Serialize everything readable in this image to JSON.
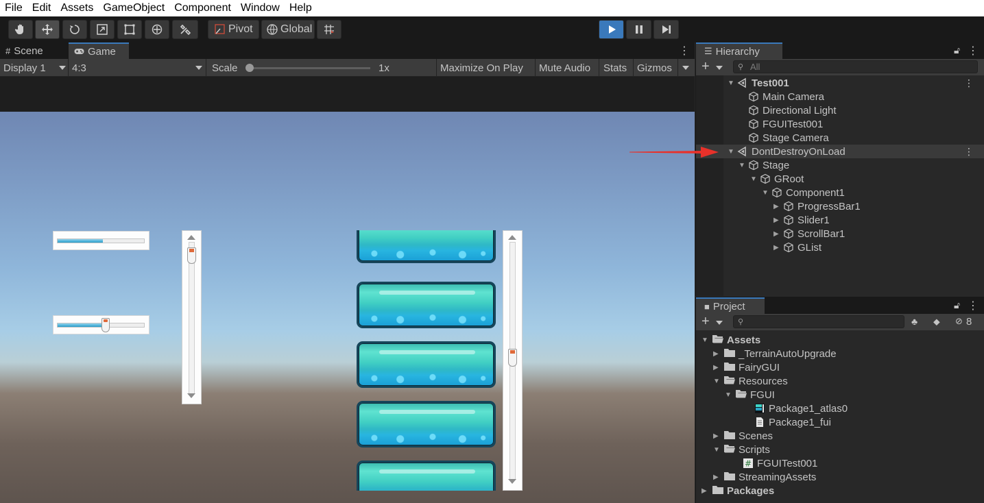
{
  "menu": [
    "File",
    "Edit",
    "Assets",
    "GameObject",
    "Component",
    "Window",
    "Help"
  ],
  "toolbar": {
    "tools": [
      "hand-tool-icon",
      "move-tool-icon",
      "rotate-tool-icon",
      "scale-tool-icon",
      "rect-tool-icon",
      "transform-tool-icon",
      "custom-tool-icon"
    ],
    "pivot_label": "Pivot",
    "global_label": "Global",
    "play_color": "#3a79bb"
  },
  "scene_panel": {
    "tabs": [
      {
        "label": "Scene",
        "icon": "grid-icon"
      },
      {
        "label": "Game",
        "icon": "gamepad-icon"
      }
    ],
    "gamebar": {
      "display": "Display 1",
      "aspect": "4:3",
      "scale_label": "Scale",
      "scale_value": "1x",
      "maximize": "Maximize On Play",
      "mute": "Mute Audio",
      "stats": "Stats",
      "gizmos": "Gizmos"
    },
    "game_view": {
      "progress_bar_value": 0.5,
      "slider_value": 0.55,
      "scrollbar_value": 0.1,
      "list_scrollbar_value": 0.5,
      "list_item_count": 5
    }
  },
  "hierarchy": {
    "tab": "Hierarchy",
    "search_placeholder": "All",
    "items": [
      {
        "label": "Test001",
        "depth": 0,
        "kind": "scene",
        "expanded": true,
        "bold": true,
        "kebab": true
      },
      {
        "label": "Main Camera",
        "depth": 1,
        "kind": "object"
      },
      {
        "label": "Directional Light",
        "depth": 1,
        "kind": "object"
      },
      {
        "label": "FGUITest001",
        "depth": 1,
        "kind": "object"
      },
      {
        "label": "Stage Camera",
        "depth": 1,
        "kind": "object"
      },
      {
        "label": "DontDestroyOnLoad",
        "depth": 0,
        "kind": "scene",
        "expanded": true,
        "kebab": true,
        "selected": true
      },
      {
        "label": "Stage",
        "depth": 1,
        "kind": "object",
        "expanded": true
      },
      {
        "label": "GRoot",
        "depth": 2,
        "kind": "object",
        "expanded": true
      },
      {
        "label": "Component1",
        "depth": 3,
        "kind": "object",
        "expanded": true
      },
      {
        "label": "ProgressBar1",
        "depth": 4,
        "kind": "object",
        "collapsed": true
      },
      {
        "label": "Slider1",
        "depth": 4,
        "kind": "object",
        "collapsed": true
      },
      {
        "label": "ScrollBar1",
        "depth": 4,
        "kind": "object",
        "collapsed": true
      },
      {
        "label": "GList",
        "depth": 4,
        "kind": "object",
        "collapsed": true
      }
    ]
  },
  "project": {
    "tab": "Project",
    "hidden_count": "8",
    "items": [
      {
        "label": "Assets",
        "depth": 0,
        "kind": "folder-open",
        "expanded": true,
        "bold": true
      },
      {
        "label": "_TerrainAutoUpgrade",
        "depth": 1,
        "kind": "folder",
        "collapsed": true
      },
      {
        "label": "FairyGUI",
        "depth": 1,
        "kind": "folder",
        "collapsed": true
      },
      {
        "label": "Resources",
        "depth": 1,
        "kind": "folder-open",
        "expanded": true
      },
      {
        "label": "FGUI",
        "depth": 2,
        "kind": "folder-open",
        "expanded": true
      },
      {
        "label": "Package1_atlas0",
        "depth": 3,
        "kind": "texture"
      },
      {
        "label": "Package1_fui",
        "depth": 3,
        "kind": "file"
      },
      {
        "label": "Scenes",
        "depth": 1,
        "kind": "folder",
        "collapsed": true
      },
      {
        "label": "Scripts",
        "depth": 1,
        "kind": "folder-open",
        "expanded": true
      },
      {
        "label": "FGUITest001",
        "depth": 2,
        "kind": "script"
      },
      {
        "label": "StreamingAssets",
        "depth": 1,
        "kind": "folder",
        "collapsed": true
      },
      {
        "label": "Packages",
        "depth": 0,
        "kind": "folder",
        "collapsed": true,
        "bold": true
      }
    ]
  }
}
